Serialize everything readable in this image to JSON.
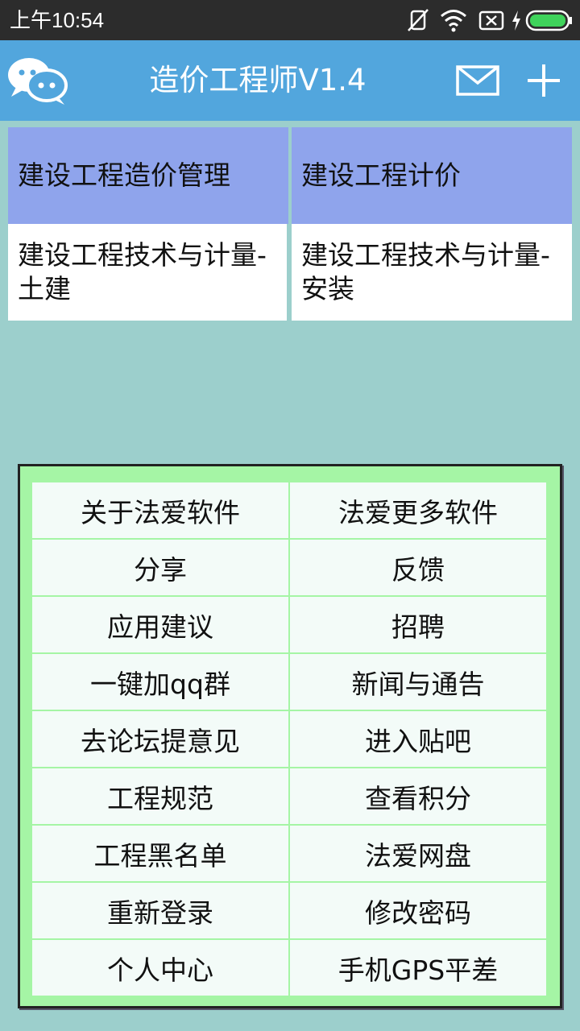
{
  "status_bar": {
    "time": "上午10:54",
    "icons": [
      "mute-icon",
      "wifi-icon",
      "sim-off-icon",
      "charging-icon",
      "battery-icon"
    ]
  },
  "header": {
    "title": "造价工程师V1.4",
    "icons": [
      "chat-bubbles-icon",
      "mail-icon",
      "plus-icon"
    ]
  },
  "courses": {
    "row1": [
      "建设工程造价管理",
      "建设工程计价"
    ],
    "row2": [
      "建设工程技术与计量-\n土建",
      "建设工程技术与计量-\n安装"
    ]
  },
  "menu": {
    "items": [
      "关于法爱软件",
      "法爱更多软件",
      "分享",
      "反馈",
      "应用建议",
      "招聘",
      "一键加qq群",
      "新闻与通告",
      "去论坛提意见",
      "进入贴吧",
      "工程规范",
      "查看积分",
      "工程黑名单",
      "法爱网盘",
      "重新登录",
      "修改密码",
      "个人中心",
      "手机GPS平差"
    ]
  },
  "colors": {
    "status_bar": "#2c2c2c",
    "title_bar": "#52a6dd",
    "page_bg": "#9ccfcc",
    "course_header": "#8fa4ec",
    "menu_panel": "#a5f5a5",
    "menu_item": "#f3fbf8"
  }
}
